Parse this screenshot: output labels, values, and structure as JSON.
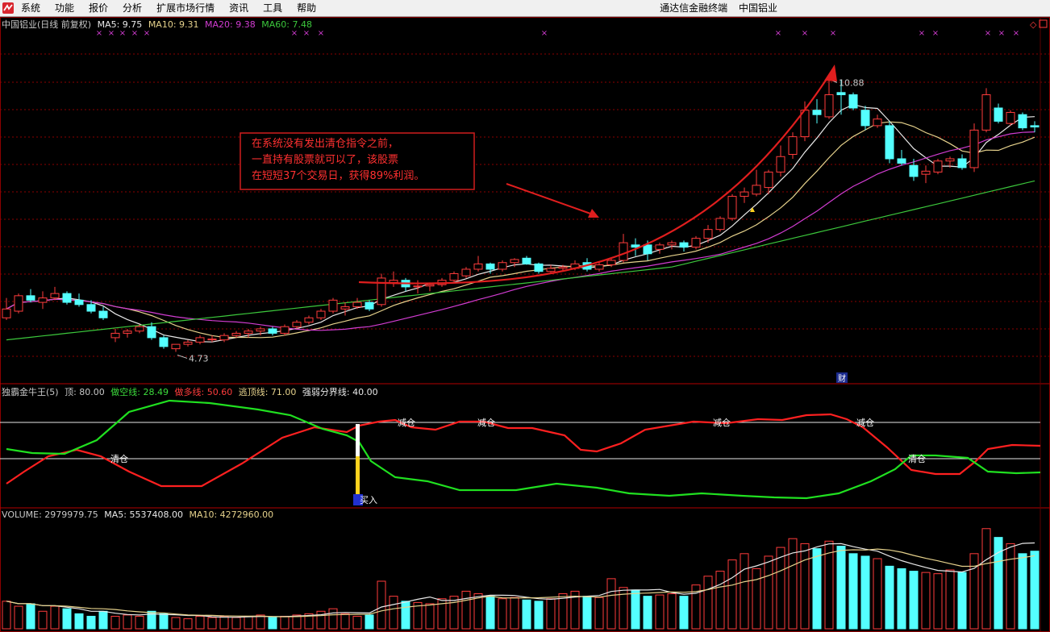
{
  "menu": {
    "items": [
      "系统",
      "功能",
      "报价",
      "分析",
      "扩展市场行情",
      "资讯",
      "工具",
      "帮助"
    ],
    "right_title": "通达信金融终端",
    "right_stock": "中国铝业"
  },
  "colors": {
    "up": "#ff3c3c",
    "down": "#54ffff",
    "ma5": "#e8e8e8",
    "ma10": "#e6d28c",
    "ma20": "#d13cd1",
    "ma60": "#3cc83c",
    "grid": "#8c0000",
    "red_line": "#ff2020",
    "green_line": "#20e020",
    "arrow": "#e01e1e"
  },
  "price_panel": {
    "title": "中国铝业(日线 前复权)",
    "ma5_label": "MA5: 9.75",
    "ma10_label": "MA10: 9.31",
    "ma20_label": "MA20: 9.38",
    "ma60_label": "MA60: 7.48",
    "high_label": "10.88",
    "low_label": "4.73",
    "fin_label": "财",
    "annotation": [
      "在系统没有发出清仓指令之前，",
      "一直持有股票就可以了，该股票",
      "在短短37个交易日，获得89%利润。"
    ]
  },
  "indicator_panel": {
    "title": "独霸金牛王(5)",
    "top_label": "顶: 80.00",
    "short_label": "做空线: 28.49",
    "long_label": "做多线: 50.60",
    "escape_label": "逃顶线: 71.00",
    "divide_label": "强弱分界线: 40.00",
    "signal_reduce": "减仓",
    "signal_clear": "清仓",
    "signal_buy": "买入"
  },
  "volume_panel": {
    "title": "VOLUME: 2979979.75",
    "ma5_label": "MA5: 5537408.00",
    "ma10_label": "MA10: 4272960.00"
  },
  "chart_data": {
    "type": "candlestick",
    "ylim": [
      4.3,
      11.6
    ],
    "candles": [
      [
        5.5,
        5.95,
        5.45,
        5.7
      ],
      [
        5.65,
        6.05,
        5.6,
        6.0
      ],
      [
        6.0,
        6.15,
        5.85,
        5.9
      ],
      [
        5.85,
        6.1,
        5.7,
        5.95
      ],
      [
        5.95,
        6.2,
        5.9,
        6.05
      ],
      [
        6.05,
        6.1,
        5.8,
        5.85
      ],
      [
        5.9,
        6.05,
        5.75,
        5.8
      ],
      [
        5.8,
        5.9,
        5.6,
        5.65
      ],
      [
        5.65,
        5.75,
        5.45,
        5.5
      ],
      [
        5.05,
        5.25,
        4.95,
        5.15
      ],
      [
        5.15,
        5.25,
        5.05,
        5.2
      ],
      [
        5.2,
        5.35,
        5.15,
        5.3
      ],
      [
        5.3,
        5.4,
        5.0,
        5.05
      ],
      [
        5.05,
        5.1,
        4.8,
        4.85
      ],
      [
        4.8,
        4.9,
        4.73,
        4.9
      ],
      [
        4.9,
        5.0,
        4.85,
        4.95
      ],
      [
        4.95,
        5.1,
        4.9,
        5.05
      ],
      [
        5.0,
        5.1,
        4.95,
        5.02
      ],
      [
        5.0,
        5.15,
        4.95,
        5.1
      ],
      [
        5.1,
        5.2,
        5.05,
        5.15
      ],
      [
        5.15,
        5.25,
        5.05,
        5.2
      ],
      [
        5.2,
        5.3,
        5.1,
        5.25
      ],
      [
        5.25,
        5.3,
        5.1,
        5.15
      ],
      [
        5.15,
        5.35,
        5.1,
        5.3
      ],
      [
        5.3,
        5.45,
        5.25,
        5.4
      ],
      [
        5.4,
        5.55,
        5.35,
        5.5
      ],
      [
        5.5,
        5.7,
        5.45,
        5.65
      ],
      [
        5.65,
        5.95,
        5.6,
        5.9
      ],
      [
        5.7,
        5.85,
        5.55,
        5.75
      ],
      [
        5.75,
        5.95,
        5.7,
        5.85
      ],
      [
        5.85,
        5.9,
        5.65,
        5.7
      ],
      [
        5.8,
        6.5,
        5.75,
        6.4
      ],
      [
        6.3,
        6.55,
        6.2,
        6.35
      ],
      [
        6.35,
        6.4,
        6.1,
        6.2
      ],
      [
        6.2,
        6.35,
        6.05,
        6.22
      ],
      [
        6.22,
        6.3,
        6.1,
        6.25
      ],
      [
        6.25,
        6.4,
        6.2,
        6.35
      ],
      [
        6.35,
        6.55,
        6.3,
        6.5
      ],
      [
        6.45,
        6.65,
        6.4,
        6.6
      ],
      [
        6.6,
        6.9,
        6.55,
        6.72
      ],
      [
        6.72,
        6.75,
        6.5,
        6.6
      ],
      [
        6.6,
        6.8,
        6.55,
        6.75
      ],
      [
        6.75,
        6.85,
        6.65,
        6.82
      ],
      [
        6.85,
        6.9,
        6.7,
        6.72
      ],
      [
        6.72,
        6.75,
        6.5,
        6.55
      ],
      [
        6.55,
        6.7,
        6.5,
        6.62
      ],
      [
        6.62,
        6.7,
        6.55,
        6.65
      ],
      [
        6.62,
        6.8,
        6.58,
        6.72
      ],
      [
        6.75,
        6.85,
        6.55,
        6.6
      ],
      [
        6.6,
        6.75,
        6.55,
        6.7
      ],
      [
        6.7,
        6.85,
        6.65,
        6.8
      ],
      [
        6.8,
        7.4,
        6.75,
        7.2
      ],
      [
        7.15,
        7.3,
        6.9,
        7.1
      ],
      [
        7.15,
        7.25,
        6.8,
        6.95
      ],
      [
        7.05,
        7.2,
        6.95,
        7.15
      ],
      [
        7.15,
        7.25,
        7.05,
        7.2
      ],
      [
        7.2,
        7.25,
        7.0,
        7.1
      ],
      [
        7.1,
        7.35,
        7.05,
        7.3
      ],
      [
        7.3,
        7.6,
        7.2,
        7.5
      ],
      [
        7.5,
        7.8,
        7.45,
        7.75
      ],
      [
        7.75,
        8.3,
        7.7,
        8.25
      ],
      [
        8.25,
        8.45,
        8.1,
        8.35
      ],
      [
        8.3,
        8.85,
        8.25,
        8.5
      ],
      [
        8.45,
        8.85,
        8.3,
        8.8
      ],
      [
        8.8,
        9.4,
        8.7,
        9.15
      ],
      [
        9.2,
        9.7,
        9.1,
        9.6
      ],
      [
        9.6,
        10.4,
        9.5,
        10.2
      ],
      [
        10.2,
        10.45,
        9.9,
        10.1
      ],
      [
        10.05,
        10.9,
        10.0,
        10.55
      ],
      [
        10.6,
        10.88,
        10.1,
        10.55
      ],
      [
        10.55,
        10.6,
        10.2,
        10.25
      ],
      [
        10.2,
        10.3,
        9.75,
        9.85
      ],
      [
        9.85,
        10.1,
        9.8,
        10.0
      ],
      [
        9.85,
        9.95,
        9.0,
        9.1
      ],
      [
        9.1,
        9.3,
        8.95,
        9.0
      ],
      [
        8.95,
        9.1,
        8.6,
        8.7
      ],
      [
        8.75,
        8.95,
        8.55,
        8.82
      ],
      [
        8.8,
        9.1,
        8.75,
        9.05
      ],
      [
        9.05,
        9.15,
        8.9,
        9.1
      ],
      [
        9.1,
        9.2,
        8.85,
        8.9
      ],
      [
        8.9,
        9.9,
        8.8,
        9.75
      ],
      [
        9.75,
        10.7,
        9.7,
        10.55
      ],
      [
        10.25,
        10.35,
        9.9,
        9.95
      ],
      [
        9.9,
        10.2,
        9.85,
        10.15
      ],
      [
        10.1,
        10.15,
        9.75,
        9.8
      ],
      [
        9.85,
        9.95,
        9.7,
        9.82
      ]
    ],
    "volume": [
      22,
      18,
      20,
      14,
      18,
      16,
      12,
      10,
      14,
      10,
      11,
      10,
      14,
      12,
      9,
      8,
      10,
      9,
      10,
      9,
      10,
      11,
      9,
      10,
      11,
      12,
      14,
      16,
      12,
      10,
      11,
      38,
      26,
      22,
      21,
      20,
      24,
      26,
      30,
      28,
      26,
      24,
      25,
      23,
      22,
      24,
      28,
      30,
      26,
      25,
      40,
      33,
      31,
      26,
      27,
      28,
      26,
      35,
      42,
      46,
      55,
      60,
      48,
      58,
      65,
      72,
      68,
      64,
      70,
      66,
      60,
      58,
      56,
      50,
      48,
      46,
      45,
      44,
      47,
      45,
      60,
      80,
      73,
      68,
      60,
      62
    ]
  }
}
